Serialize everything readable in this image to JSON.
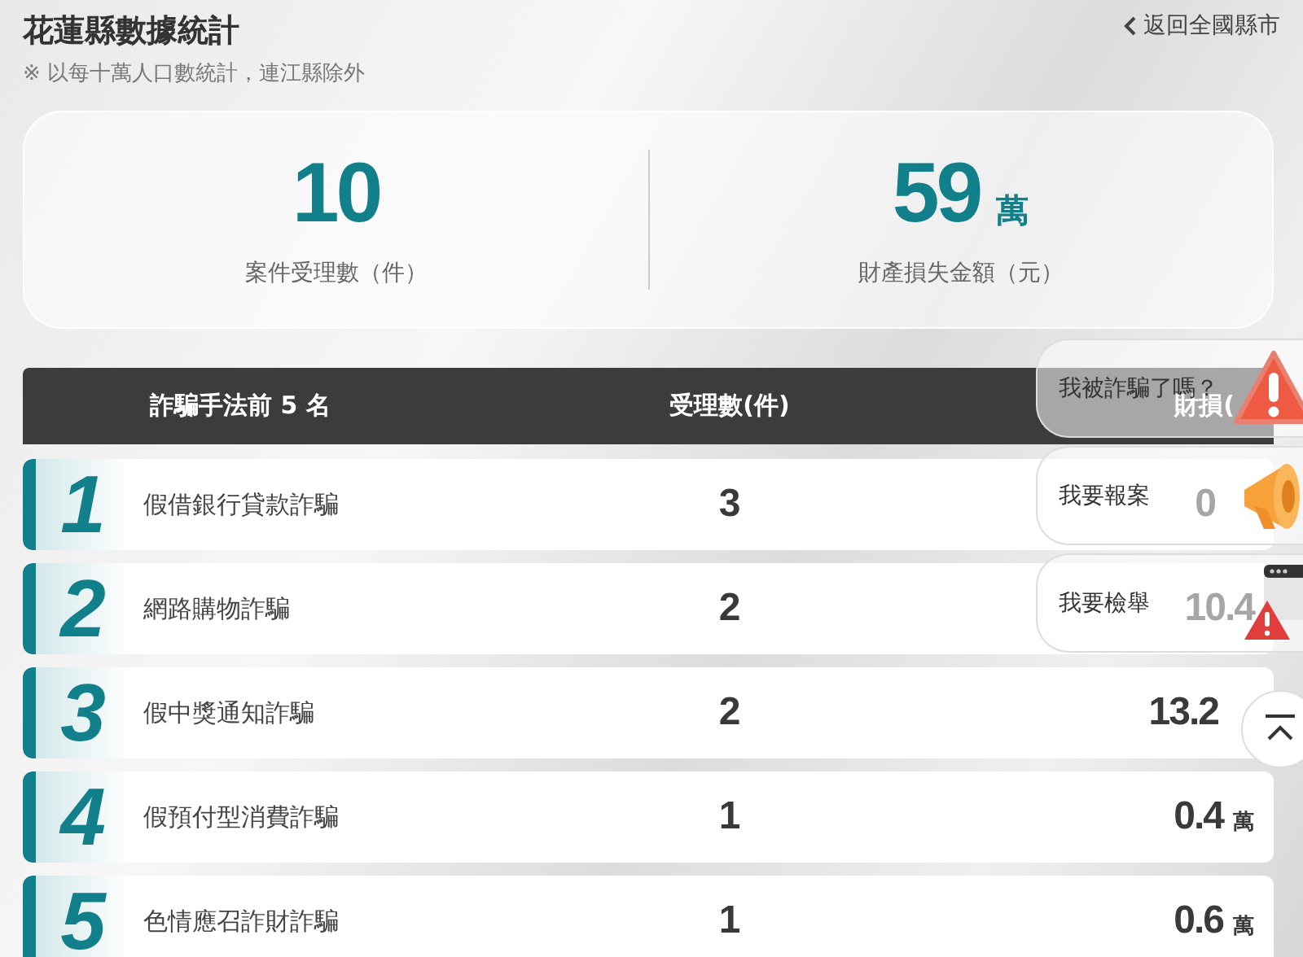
{
  "header": {
    "title": "花蓮縣數據統計",
    "note": "※ 以每十萬人口數統計，連江縣除外",
    "back_link": "返回全國縣市"
  },
  "stats": [
    {
      "value": "10",
      "label": "案件受理數（件）"
    },
    {
      "value": "59",
      "unit": "萬",
      "label": "財產損失金額（元）"
    }
  ],
  "table": {
    "columns": [
      "詐騙手法前 5 名",
      "受理數(件)",
      "財損("
    ],
    "rows": [
      {
        "rank": "1",
        "method": "假借銀行貸款詐騙",
        "count": "3",
        "loss": "0"
      },
      {
        "rank": "2",
        "method": "網路購物詐騙",
        "count": "2",
        "loss": "10.4"
      },
      {
        "rank": "3",
        "method": "假中獎通知詐騙",
        "count": "2",
        "loss": "13.2"
      },
      {
        "rank": "4",
        "method": "假預付型消費詐騙",
        "count": "1",
        "loss": "0.4",
        "unit": "萬"
      },
      {
        "rank": "5",
        "method": "色情應召詐財詐騙",
        "count": "1",
        "loss": "0.6",
        "unit": "萬"
      }
    ]
  },
  "floating_actions": [
    {
      "label": "我被詐騙了嗎？",
      "kind": "alert"
    },
    {
      "label": "我要報案",
      "kind": "megaphone"
    },
    {
      "label": "我要檢舉",
      "kind": "report"
    }
  ]
}
